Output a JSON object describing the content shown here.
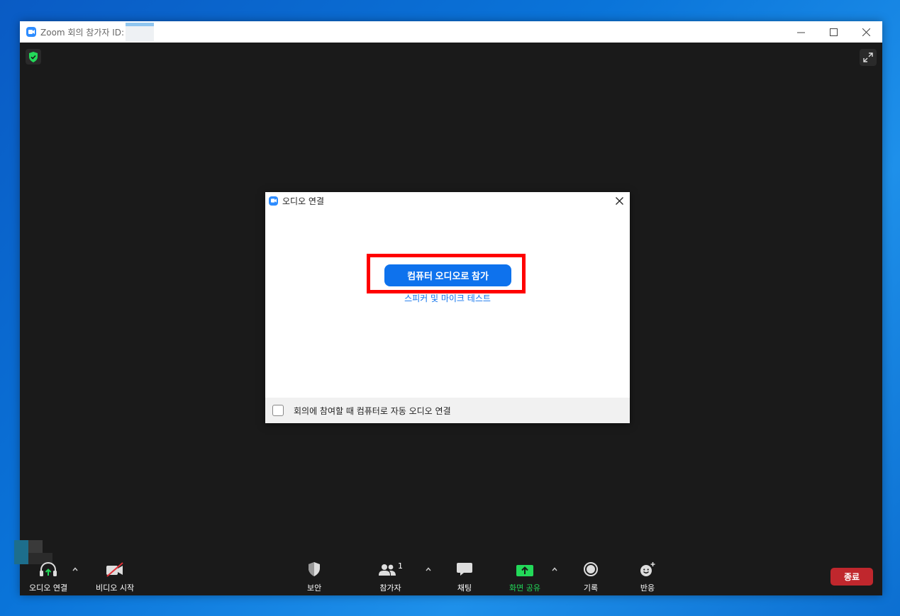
{
  "window": {
    "title": "Zoom 회의 참가자 ID:"
  },
  "dialog": {
    "title": "오디오 연결",
    "join_button": "컴퓨터 오디오로 참가",
    "test_link": "스피커 및 마이크 테스트",
    "auto_join_label": "회의에 참여할 때 컴퓨터로 자동 오디오 연결"
  },
  "toolbar": {
    "audio_label": "오디오 연결",
    "video_label": "비디오 시작",
    "security_label": "보안",
    "participants_label": "참가자",
    "participants_count": "1",
    "chat_label": "채팅",
    "share_label": "화면 공유",
    "record_label": "기록",
    "reactions_label": "반응",
    "end_label": "종료"
  },
  "colors": {
    "accent": "#0e72ed",
    "share_green": "#23d959",
    "end_red": "#c0272d",
    "highlight": "#ff0000"
  },
  "icons": [
    "zoom-logo-icon",
    "minimize-icon",
    "maximize-icon",
    "close-icon",
    "shield-check-icon",
    "fullscreen-icon",
    "headphone-icon",
    "video-off-icon",
    "security-shield-icon",
    "participants-icon",
    "chat-icon",
    "share-screen-icon",
    "record-icon",
    "reaction-icon",
    "chevron-up-icon"
  ]
}
